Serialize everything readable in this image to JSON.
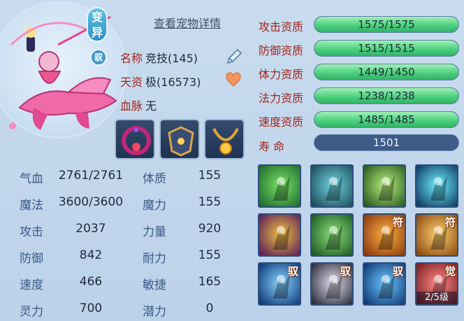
{
  "header": {
    "detail_link": "查看宠物详情",
    "variant_tag": "变异",
    "yu_tag": "驭"
  },
  "pet": {
    "name_label": "名称",
    "name_value": "竞技(145)",
    "talent_label": "天资",
    "talent_value": "极(16573)",
    "bloodline_label": "血脉",
    "bloodline_value": "无"
  },
  "icons": {
    "edit": "pencil-icon",
    "heart": "heart-icon"
  },
  "stats_left": [
    {
      "label": "气血",
      "value": "2761/2761"
    },
    {
      "label": "魔法",
      "value": "3600/3600"
    },
    {
      "label": "攻击",
      "value": "2037"
    },
    {
      "label": "防御",
      "value": "842"
    },
    {
      "label": "速度",
      "value": "466"
    },
    {
      "label": "灵力",
      "value": "700"
    }
  ],
  "stats_right": [
    {
      "label": "体质",
      "value": "155"
    },
    {
      "label": "魔力",
      "value": "155"
    },
    {
      "label": "力量",
      "value": "920"
    },
    {
      "label": "耐力",
      "value": "155"
    },
    {
      "label": "敏捷",
      "value": "165"
    },
    {
      "label": "潜力",
      "value": "0"
    }
  ],
  "aptitudes": [
    {
      "label": "攻击资质",
      "text": "1575/1575",
      "fill": 1.0
    },
    {
      "label": "防御资质",
      "text": "1515/1515",
      "fill": 1.0
    },
    {
      "label": "体力资质",
      "text": "1449/1450",
      "fill": 0.999
    },
    {
      "label": "法力资质",
      "text": "1238/1238",
      "fill": 1.0
    },
    {
      "label": "速度资质",
      "text": "1485/1485",
      "fill": 1.0
    }
  ],
  "life": {
    "label": "寿  命",
    "value": "1501"
  },
  "skills": [
    {
      "name": "skill-1",
      "badge": ""
    },
    {
      "name": "skill-2",
      "badge": ""
    },
    {
      "name": "skill-3",
      "badge": ""
    },
    {
      "name": "skill-4",
      "badge": ""
    },
    {
      "name": "skill-5",
      "badge": ""
    },
    {
      "name": "skill-6",
      "badge": ""
    },
    {
      "name": "skill-7",
      "badge": "符"
    },
    {
      "name": "skill-8",
      "badge": "符"
    },
    {
      "name": "skill-9",
      "badge": "驭"
    },
    {
      "name": "skill-10",
      "badge": "驭"
    },
    {
      "name": "skill-11",
      "badge": "驭"
    },
    {
      "name": "skill-12",
      "badge": "觉",
      "level": "2/5级"
    }
  ],
  "colors": {
    "accent_red": "#a0261d",
    "bar_green": "#4ed07f",
    "bar_bg": "#3e5a86"
  }
}
